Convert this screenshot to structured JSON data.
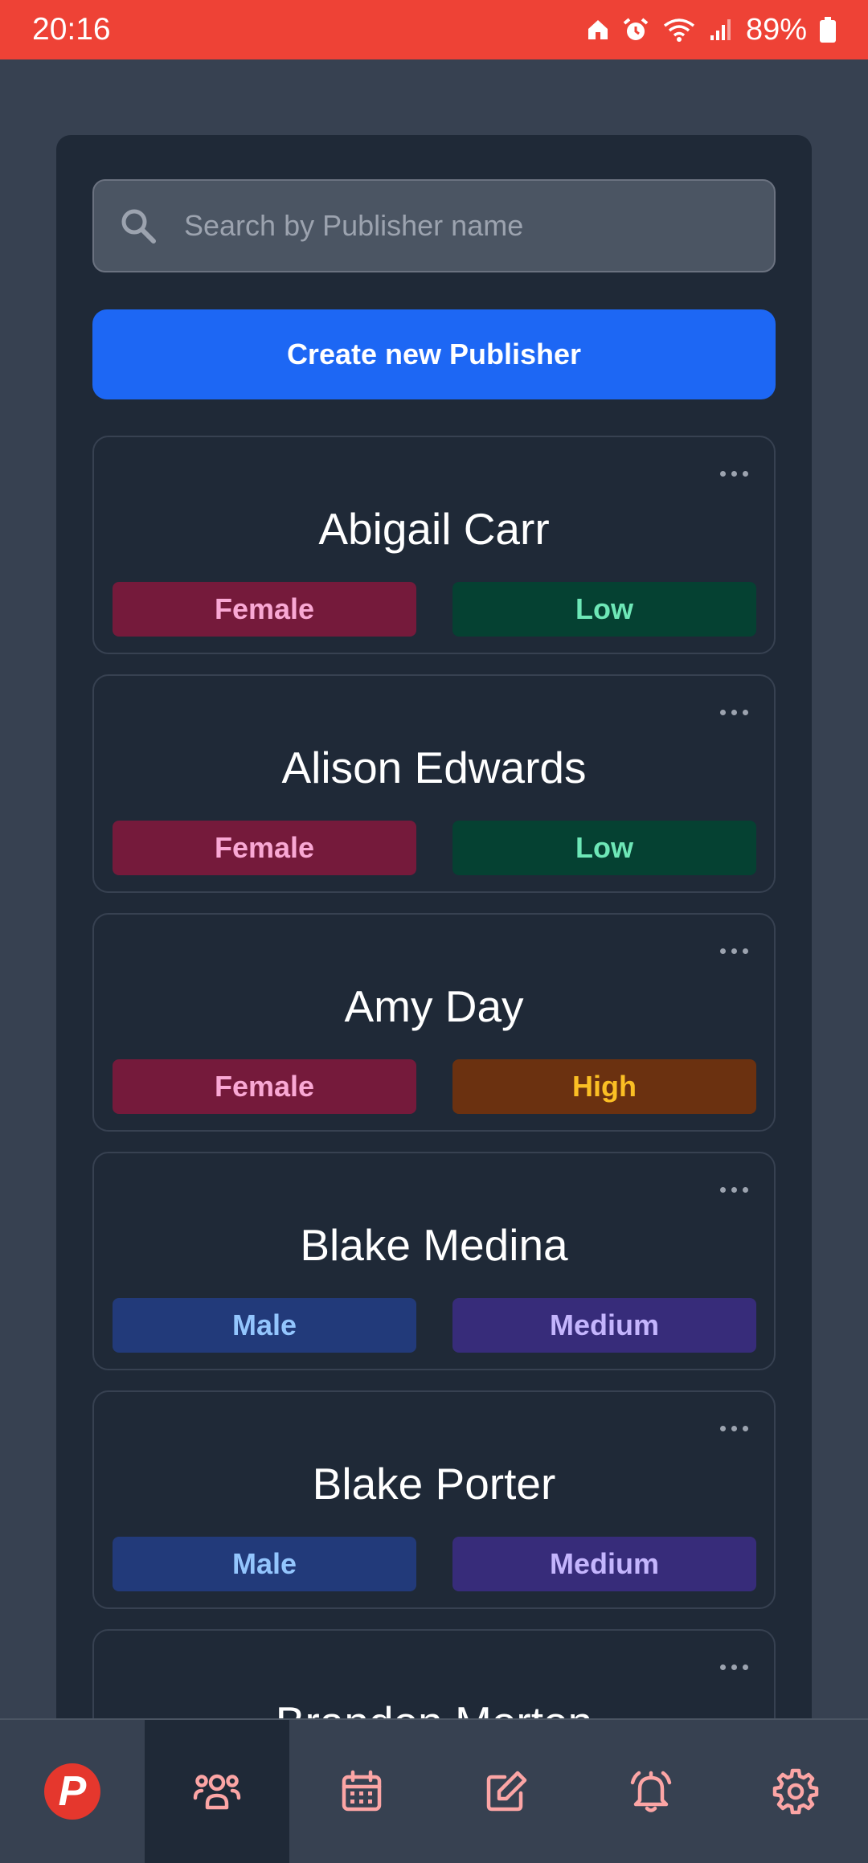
{
  "status_bar": {
    "time": "20:16",
    "battery": "89%"
  },
  "search": {
    "placeholder": "Search by Publisher name"
  },
  "create_button": "Create new Publisher",
  "publishers": [
    {
      "name": "Abigail Carr",
      "gender": "Female",
      "level": "Low"
    },
    {
      "name": "Alison Edwards",
      "gender": "Female",
      "level": "Low"
    },
    {
      "name": "Amy Day",
      "gender": "Female",
      "level": "High"
    },
    {
      "name": "Blake Medina",
      "gender": "Male",
      "level": "Medium"
    },
    {
      "name": "Blake Porter",
      "gender": "Male",
      "level": "Medium"
    },
    {
      "name": "Brandon Morton",
      "gender": "",
      "level": ""
    }
  ],
  "bottom_nav": {
    "logo_letter": "P",
    "items": [
      "logo",
      "people-icon",
      "calendar-icon",
      "edit-icon",
      "bell-icon",
      "gear-icon"
    ],
    "active": "people-icon",
    "icon_color": "#fca5a5"
  },
  "colors": {
    "status_bar": "#ee4236",
    "accent": "#1d67f4",
    "background": "#374151",
    "panel": "#1f2937"
  }
}
